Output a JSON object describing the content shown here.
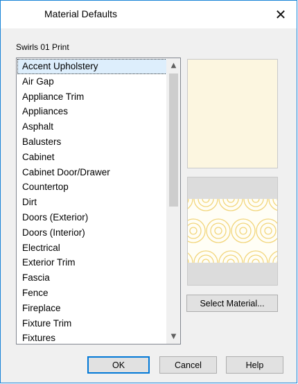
{
  "dialog": {
    "title": "Material Defaults",
    "close_glyph": "✕",
    "subtitle": "Swirls 01 Print"
  },
  "list": {
    "items": [
      "Accent Upholstery",
      "Air Gap",
      "Appliance Trim",
      "Appliances",
      "Asphalt",
      "Balusters",
      "Cabinet",
      "Cabinet Door/Drawer",
      "Countertop",
      "Dirt",
      "Doors (Exterior)",
      "Doors (Interior)",
      "Electrical",
      "Exterior Trim",
      "Fascia",
      "Fence",
      "Fireplace",
      "Fixture Trim",
      "Fixtures"
    ],
    "selected_index": 0,
    "scroll_up_glyph": "▲",
    "scroll_down_glyph": "▼"
  },
  "preview": {
    "swatch_color": "#fcf6e0",
    "pattern_color": "#f2d57a"
  },
  "buttons": {
    "select_material": "Select Material...",
    "ok": "OK",
    "cancel": "Cancel",
    "help": "Help"
  }
}
